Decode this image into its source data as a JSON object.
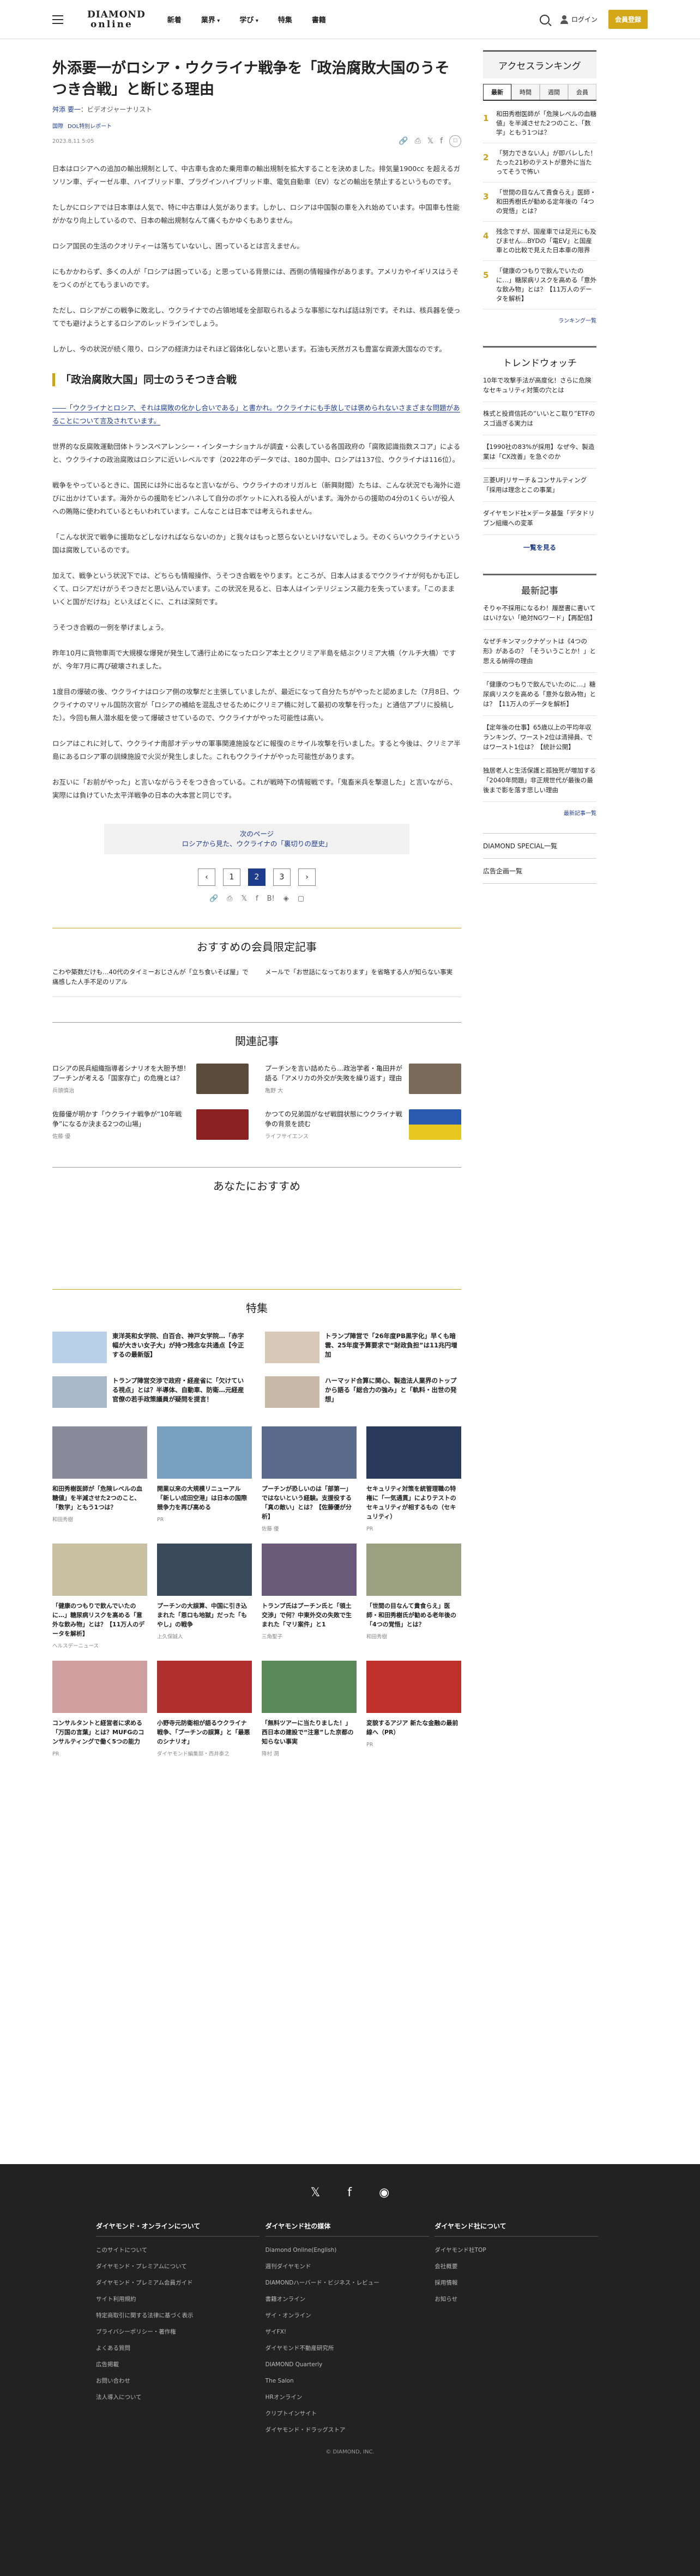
{
  "header": {
    "logo_l1": "DIAMOND",
    "logo_l2": "online",
    "nav": [
      "新着",
      "業界",
      "学び",
      "特集",
      "書籍"
    ],
    "login": "ログイン",
    "register": "会員登録"
  },
  "article": {
    "title": "外添要一がロシア・ウクライナ戦争を「政治腐敗大国のうそつき合戦」と断じる理由",
    "author": "舛添 要一",
    "author_role": "：ビデオジャーナリスト",
    "cats": [
      "国際",
      "DOL特別レポート"
    ],
    "date": "2023.8.11 5:05",
    "p": [
      "日本はロシアへの追加の輸出規制として、中古車も含めた乗用車の輸出規制を拡大することを決めました。排気量1900cc を超えるガソリン車、ディーゼル車、ハイブリッド車、プラグインハイブリッド車、電気自動車（EV）などの輸出を禁止するというものです。",
      "たしかにロシアでは日本車は人気で、特に中古車は人気があります。しかし、ロシアは中国製の車を入れ始めています。中国車も性能がかなり向上しているので、日本の輸出規制なんて痛くもかゆくもありません。",
      "ロシア国民の生活のクオリティーは落ちていないし、困っているとは言えません。",
      "にもかかわらず、多くの人が「ロシアは困っている」と思っている背景には、西側の情報操作があります。アメリカやイギリスはうそをつくのがとてもうまいのです。",
      "ただし、ロシアがこの戦争に敗北し、ウクライナでの占領地域を全部取られるような事態になれば話は別です。それは、核兵器を使ってでも避けようとするロシアのレッドラインでしょう。",
      "しかし、今の状況が続く限り、ロシアの経済力はそれほど弱体化しないと思います。石油も天然ガスも豊富な資源大国なのです。"
    ],
    "sub": "「政治腐敗大国」同士のうそつき合戦",
    "quote": "――「ウクライナとロシア、それは腐敗の化かし合いである」と書かれ。ウクライナにも手放しでは褒められないさまざまな問題があることについて言及されています。",
    "p2": [
      "世界的な反腐敗運動団体トランスペアレンシー・インターナショナルが調査・公表している各国政府の「腐敗認識指数スコア」によると、ウクライナの政治腐敗はロシアに近いレベルです（2022年のデータでは、180カ国中、ロシアは137位、ウクライナは116位）。",
      "戦争をやっているときに、国民には外に出るなと言いながら、ウクライナのオリガルヒ（新興財閥）たちは、こんな状況でも海外に遊びに出かけています。海外からの援助をピンハネして自分のポケットに入れる役人がいます。海外からの援助の4分の1くらいが役人への賄賂に使われているともいわれています。こんなことは日本では考えられません。",
      "「こんな状況で戦争に援助などしなければならないのか」と我々はもっと怒らないといけないでしょう。そのくらいウクライナという国は腐敗しているのです。",
      "加えて、戦争という状況下では、どちらも情報操作、うそつき合戦をやります。ところが、日本人はまるでウクライナが何もかも正しくて、ロシアだけがうそつきだと思い込んでいます。この状況を見ると、日本人はインテリジェンス能力を失っています。「このままいくと国がだけね」といえばとくに、これは深刻です。",
      "うそつき合戦の一例を挙げましょう。",
      "昨年10月に貨物車両で大規模な爆発が発生して通行止めになったロシア本土とクリミア半島を結ぶクリミア大橋（ケルチ大橋）ですが、今年7月に再び破壊されました。",
      "1度目の爆破の後、ウクライナはロシア側の攻撃だと主張していましたが、最近になって自分たちがやったと認めました（7月8日、ウクライナのマリャル国防次官が「ロシアの補給を混乱させるためにクリミア橋に対して最初の攻撃を行った」と通信アプリに投稿した）。今回も無人潜水艇を使って爆破させているので、ウクライナがやった可能性は高い。",
      "ロシアはこれに対して、ウクライナ南部オデッサの軍事関連施設などに報復のミサイル攻撃を行いました。すると今後は、クリミア半島にあるロシア軍の訓練施設で火災が発生しました。これもウクライナがやった可能性があります。",
      "お互いに「お前がやった」と言いながらうそをつき合っている。これが戦時下の情報戦です。「鬼畜米兵を撃退した」と言いながら、実際には負けていた太平洋戦争の日本の大本営と同じです。"
    ],
    "next_label": "次のページ",
    "next_title": "ロシアから見た、ウクライナの「裏切りの歴史」",
    "pages": [
      "‹",
      "1",
      "2",
      "3",
      "›"
    ]
  },
  "member": {
    "title": "おすすめの会員限定記事",
    "items": [
      "こわや築数だけも…40代のタイミーおじさんが「立ち食いそば屋」で痛感した人手不足のリアル",
      "メールで「お世話になっております」を省略する人が知らない事実"
    ]
  },
  "related": {
    "title": "関連記事",
    "items": [
      {
        "t": "ロシアの民兵組織指導者シナリオを大胆予想！プーチンが考える「国家存亡」の危機とは？",
        "a": "兵頭慎治"
      },
      {
        "t": "プーチンを言い詰めたら…政治学者・亀田井が語る「アメリカの外交が失敗を繰り返す」理由",
        "a": "亀野 大"
      },
      {
        "t": "佐藤優が明かす「ウクライナ戦争が“10年戦争”になるか決まる2つの山場」",
        "a": "佐藤 優"
      },
      {
        "t": "かつての兄弟国がなぜ戦闘状態にウクライナ戦争の背景を読む",
        "a": "ライフサイエンス"
      }
    ]
  },
  "recommend_title": "あなたにおすすめ",
  "feature": {
    "title": "特集",
    "items": [
      "東洋英和女学院、白百合、神戸女学院…「赤字幅が大きい女子大」が持つ残念な共通点【今正するの最新版】",
      "トランプ陣営で「26年度PB黒字化」早くも暗雲、25年度予算要求で“財政負担”は11兆円増加",
      "トランプ陣営交渉で政府・経産省に「欠けている視点」とは？半導体、自動車、防衛…元経産官僚の若手政策議員が疑問を提言！",
      "ハーマッド合算に関心、製造法人業界のトップから語る「総合力の強み」と「軌料・出世の発想」"
    ]
  },
  "grid": [
    {
      "t": "和田秀樹医師が「危険レベルの血糖値」を半減させた2つのこと、「数学」ともう1つは？",
      "s": "和田秀樹"
    },
    {
      "t": "開業以来の大規模リニューアル「新しい成田空港」は日本の国際競争力を再び高める",
      "s": "PR"
    },
    {
      "t": "プーチンが恐しいのは「部第一」ではないという経験。支援役する「真の敵い」とは？【佐藤優が分析】",
      "s": "佐藤 優"
    },
    {
      "t": "セキュリティ対策を統管理職の特権に「一気通貫」によりテストのセキュリティが相するもの（セキュリティ）",
      "s": "PR"
    },
    {
      "t": "「健康のつもりで飲んでいたのに…」糖尿病リスクを高める「意外な飲み物」とは？【11万人のデータを解析】",
      "s": "ヘルスデーニュース"
    },
    {
      "t": "プーチンの大誤算、中国に引き込まれた「恩ロも地獄」だった「もやし」の戦争",
      "s": "上久保誠人"
    },
    {
      "t": "トランプ氏はプーチン氏と「領土交渉」で何？中東外交の失敗で生まれた「マリ案件」と1",
      "s": "三角聖子"
    },
    {
      "t": "「世間の目なんて貴食らえ」医師・和田秀樹氏が勧める老年後の「4つの覚悟」とは？",
      "s": "和田秀樹"
    },
    {
      "t": "コンサルタントと経営者に求める「万国の言葉」とは？MUFGのコンサルティングで働く5つの能力",
      "s": "PR"
    },
    {
      "t": "小野寺元防衛相が語るウクライナ戦争、「プーチンの誤算」と「最悪のシナリオ」",
      "s": "ダイヤモンド編集部・西井泰之"
    },
    {
      "t": "「無料ツアーに当たりました！」西日本の建設で“注意”した京都の知らない事実",
      "s": "降村 潤"
    },
    {
      "t": "変貌するアジア 新たな金融の最前線へ（PR）",
      "s": "PR"
    }
  ],
  "sidebar": {
    "rank_title": "アクセスランキング",
    "tabs": [
      "最新",
      "時間",
      "週間",
      "会員"
    ],
    "rank": [
      "和田秀樹医師が「危険レベルの血糖値」を半減させた2つのこと、「数学」ともう1つは？",
      "「努力できない人」が即バレした！たった21秒のテストが意外に当たってそうで怖い",
      "「世間の目なんて貴食らえ」医師・和田秀樹氏が勧める定年後の「4つの覚悟」とは？",
      "残念ですが、国産車では足元にも及びません…BYDの「電EV」と国産車との比較で見えた日本車の限界",
      "「健康のつもりで飲んでいたのに…」糖尿病リスクを高める「意外な飲み物」とは？【11万人のデータを解析】"
    ],
    "rank_more": "ランキング一覧",
    "trend_title": "トレンドウォッチ",
    "trend": [
      "10年で攻撃手法が高度化！さらに危険なセキュリティ対策の穴とは",
      "株式と投資信託の“いいとこ取り”ETFのスゴ過ぎる実力は",
      "【1990社の83%が採用】なぜ今、製造業は「CX改善」を急ぐのか",
      "三菱UFJリサーチ＆コンサルティング「採用は理念とこの事業」",
      "ダイヤモンド社×データ基盤「デタドリブン組織への変革"
    ],
    "trend_more": "一覧を見る",
    "latest_title": "最新記事",
    "latest": [
      "そりゃ不採用になるわ！履歴書に書いてはいけない「絶対NGワード」【再配信】",
      "なぜチキンマックナゲットは《4つの形》があるの？「そういうことか！」と思える納得の理由",
      "「健康のつもりで飲んでいたのに…」糖尿病リスクを高める「意外な飲み物」とは？【11万人のデータを解析】",
      "【定年後の仕事】65歳以上の平均年収ランキング、ワースト2位は清掃員、ではワースト1位は？【統計公開】",
      "独居老人と生活保護と孤独死が増加する「2040年問題」非正規世代が最後の最後まで影を落す悲しい理由"
    ],
    "latest_more": "最新記事一覧",
    "ds1": "DIAMOND SPECIAL一覧",
    "ds2": "広告企画一覧"
  },
  "footer": {
    "icons": [
      "𝕏",
      "f",
      "◉"
    ],
    "c1_title": "ダイヤモンド・オンラインについて",
    "c1": [
      "このサイトについて",
      "ダイヤモンド・プレミアムについて",
      "ダイヤモンド・プレミアム会員ガイド",
      "サイト利用規約",
      "特定商取引に関する法律に基づく表示",
      "プライバシーポリシー・著作権",
      "よくある質問",
      "広告掲載",
      "お問い合わせ",
      "法人導入について"
    ],
    "c2_title": "ダイヤモンド社の媒体",
    "c2": [
      "Diamond Online(English)",
      "週刊ダイヤモンド",
      "DIAMONDハーバード・ビジネス・レビュー",
      "書籍オンライン",
      "ザイ・オンライン",
      "ザイFX!",
      "ダイヤモンド不動産研究所",
      "DIAMOND Quarterly",
      "The Salon",
      "HRオンライン",
      "クリプトインサイト",
      "ダイヤモンド・ドラッグストア"
    ],
    "c3_title": "ダイヤモンド社について",
    "c3": [
      "ダイヤモンド社TOP",
      "会社概要",
      "採用情報",
      "お知らせ"
    ],
    "copyright": "© DIAMOND, INC."
  }
}
